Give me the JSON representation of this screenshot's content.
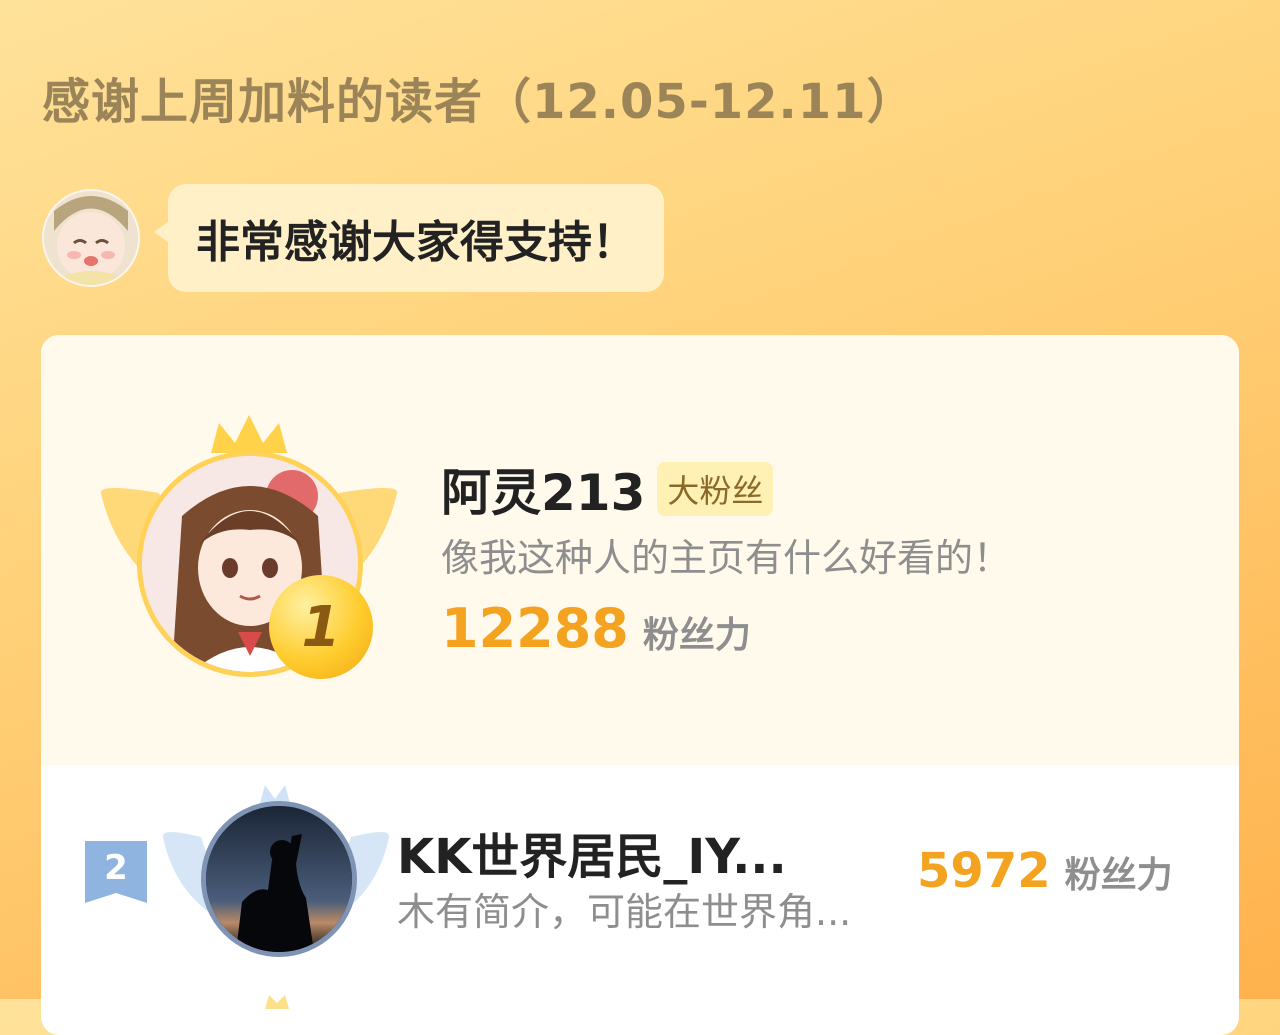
{
  "header": {
    "title": "感谢上周加料的读者（12.05-12.11）"
  },
  "greeting": {
    "avatar_icon": "baby-face-avatar-icon",
    "message": "非常感谢大家得支持！"
  },
  "ranking": [
    {
      "rank": "1",
      "name": "阿灵213",
      "tag": "大粉丝",
      "bio": "像我这种人的主页有什么好看的！",
      "score": "12288",
      "score_unit": "粉丝力",
      "avatar_icon": "anime-girl-avatar-icon",
      "badge_color": "#ffcc2e"
    },
    {
      "rank": "2",
      "name": "KK世界居民_IY...",
      "bio": "木有简介，可能在世界角...",
      "score": "5972",
      "score_unit": "粉丝力",
      "avatar_icon": "silhouette-sunset-avatar-icon",
      "badge_color": "#7fa6d6"
    }
  ],
  "colors": {
    "accent": "#f3a31f",
    "title": "#9b8457",
    "muted": "#8e8e8e",
    "bubble": "#fff0c8"
  }
}
